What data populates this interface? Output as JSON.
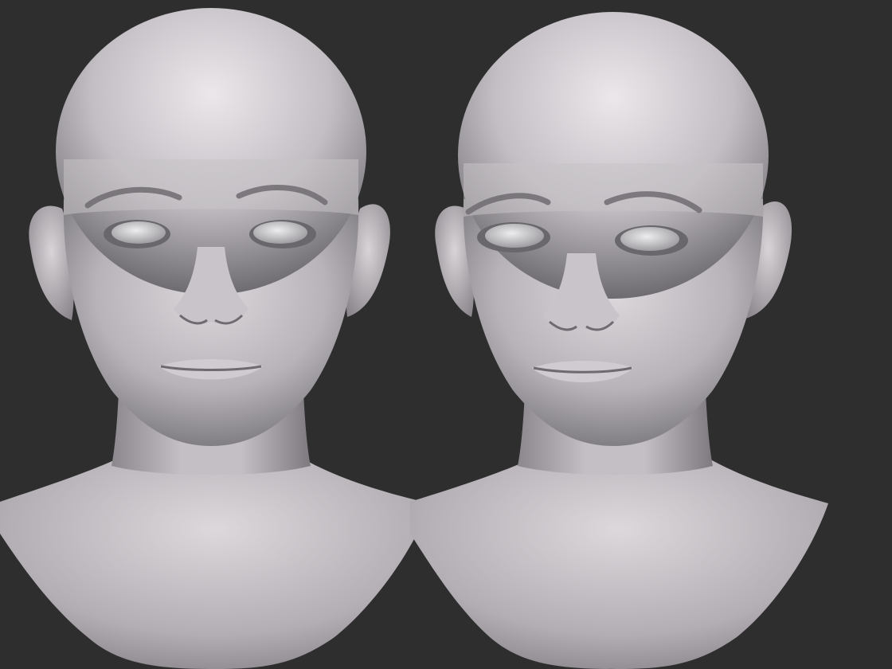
{
  "scene": {
    "background_color": "#2e2e2f",
    "skin_color": "#bcb8bd",
    "skin_highlight": "#e6e2e6",
    "skin_shadow": "#5a575c",
    "eye_color": "#c9c7cb"
  },
  "models": [
    {
      "id": "left-bust",
      "view": "front"
    },
    {
      "id": "right-bust",
      "view": "front"
    }
  ]
}
